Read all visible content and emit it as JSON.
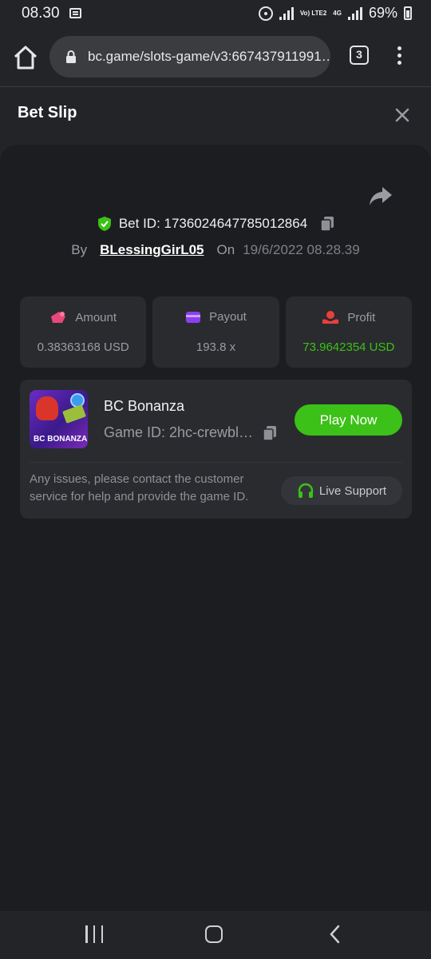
{
  "status_bar": {
    "time": "08.30",
    "network": "Vo) LTE2",
    "network_type": "4G",
    "battery": "69%"
  },
  "browser": {
    "url": "bc.game/slots-game/v3:667437911991…",
    "tab_count": "3"
  },
  "bet_slip": {
    "title": "Bet Slip",
    "bet_id_label": "Bet ID: 1736024647785012864",
    "by_label": "By",
    "username": "BLessingGirL05",
    "on_label": "On",
    "date": "19/6/2022 08.28.39"
  },
  "stats": [
    {
      "label": "Amount",
      "value": "0.38363168 USD",
      "icon": "amount-icon",
      "color": "#e8477a"
    },
    {
      "label": "Payout",
      "value": "193.8 x",
      "icon": "payout-icon",
      "color": "#8b3ff0"
    },
    {
      "label": "Profit",
      "value": "73.9642354 USD",
      "icon": "profit-icon",
      "color": "#e8413a"
    }
  ],
  "game": {
    "title": "BC Bonanza",
    "game_id": "Game ID: 2hc-crewbl…",
    "thumb_text": "BC BONANZA",
    "play_label": "Play Now",
    "issue_text": "Any issues, please contact the customer service for help and provide the game ID.",
    "support_label": "Live Support"
  },
  "colors": {
    "accent_green": "#3bc117",
    "panel": "#1c1d20",
    "card": "#2a2b2f"
  }
}
